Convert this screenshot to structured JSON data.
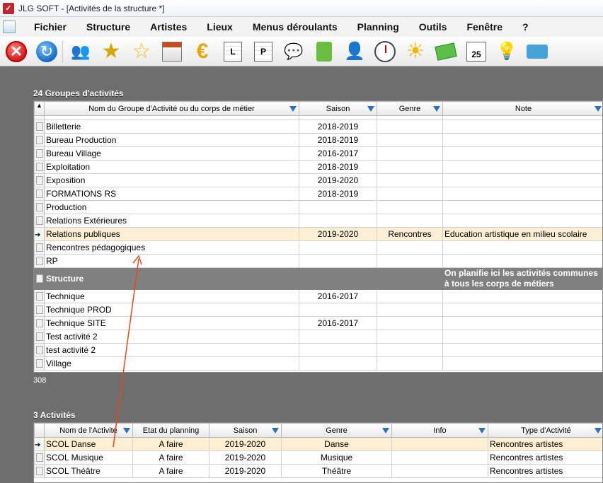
{
  "window": {
    "title": "JLG SOFT - [Activités de la structure *]"
  },
  "menu": [
    "Fichier",
    "Structure",
    "Artistes",
    "Lieux",
    "Menus déroulants",
    "Planning",
    "Outils",
    "Fenêtre",
    "?"
  ],
  "toolbar_icons": [
    "close-icon",
    "refresh-icon",
    "people-icon",
    "star-gold-icon",
    "star-icon",
    "calendar-icon",
    "euro-icon",
    "letter-l-icon",
    "letter-p-icon",
    "chat-bubble-icon",
    "green-book-icon",
    "person-euro-icon",
    "clock-icon",
    "sun-icon",
    "mail-icon",
    "date-25-icon",
    "bulb-icon",
    "card-icon"
  ],
  "toolbar_text": {
    "letter_l": "L",
    "letter_p": "P",
    "date": "25"
  },
  "groups": {
    "title": "24 Groupes d'activités",
    "footer_count": "308",
    "columns": [
      "Nom du Groupe d'Activité ou du corps de métier",
      "Saison",
      "Genre",
      "Note"
    ],
    "rows": [
      {
        "name": "Billetterie",
        "saison": "2018-2019",
        "genre": "",
        "note": ""
      },
      {
        "name": "Bureau Production",
        "saison": "2018-2019",
        "genre": "",
        "note": ""
      },
      {
        "name": "Bureau Village",
        "saison": "2016-2017",
        "genre": "",
        "note": ""
      },
      {
        "name": "Exploitation",
        "saison": "2018-2019",
        "genre": "",
        "note": ""
      },
      {
        "name": "Exposition",
        "saison": "2019-2020",
        "genre": "",
        "note": ""
      },
      {
        "name": "FORMATIONS RS",
        "saison": "2018-2019",
        "genre": "",
        "note": ""
      },
      {
        "name": "Production",
        "saison": "",
        "genre": "",
        "note": ""
      },
      {
        "name": "Relations Extérieures",
        "saison": "",
        "genre": "",
        "note": ""
      },
      {
        "name": "Relations publiques",
        "saison": "2019-2020",
        "genre": "Rencontres",
        "note": "Education artistique en milieu scolaire",
        "current": true
      },
      {
        "name": "Rencontres pédagogiques",
        "saison": "",
        "genre": "",
        "note": ""
      },
      {
        "name": "RP",
        "saison": "",
        "genre": "",
        "note": ""
      },
      {
        "group": true,
        "name": "Structure",
        "note": "On planifie ici les activités communes à tous les corps de métiers"
      },
      {
        "name": "Technique",
        "saison": "2016-2017",
        "genre": "",
        "note": ""
      },
      {
        "name": "Technique PROD",
        "saison": "",
        "genre": "",
        "note": ""
      },
      {
        "name": "Technique SITE",
        "saison": "2016-2017",
        "genre": "",
        "note": ""
      },
      {
        "name": "Test activité 2",
        "saison": "",
        "genre": "",
        "note": ""
      },
      {
        "name": "test activité 2",
        "saison": "",
        "genre": "",
        "note": ""
      },
      {
        "name": "Village",
        "saison": "",
        "genre": "",
        "note": ""
      }
    ]
  },
  "activities": {
    "title": "3 Activités",
    "columns": [
      "Nom de l'Activité",
      "Etat du planning",
      "Saison",
      "Genre",
      "Info",
      "Type d'Activité"
    ],
    "rows": [
      {
        "name": "SCOL Danse",
        "etat": "A faire",
        "saison": "2019-2020",
        "genre": "Danse",
        "info": "",
        "type": "Rencontres artistes",
        "current": true
      },
      {
        "name": "SCOL Musique",
        "etat": "A faire",
        "saison": "2019-2020",
        "genre": "Musique",
        "info": "",
        "type": "Rencontres artistes"
      },
      {
        "name": "SCOL Théâtre",
        "etat": "A faire",
        "saison": "2019-2020",
        "genre": "Théâtre",
        "info": "",
        "type": "Rencontres artistes"
      }
    ]
  },
  "colors": {
    "current_row": "#fcefd3",
    "group_row": "#808080",
    "annotation_arrow": "#e8471c",
    "filter_icon": "#2d6fc3"
  }
}
